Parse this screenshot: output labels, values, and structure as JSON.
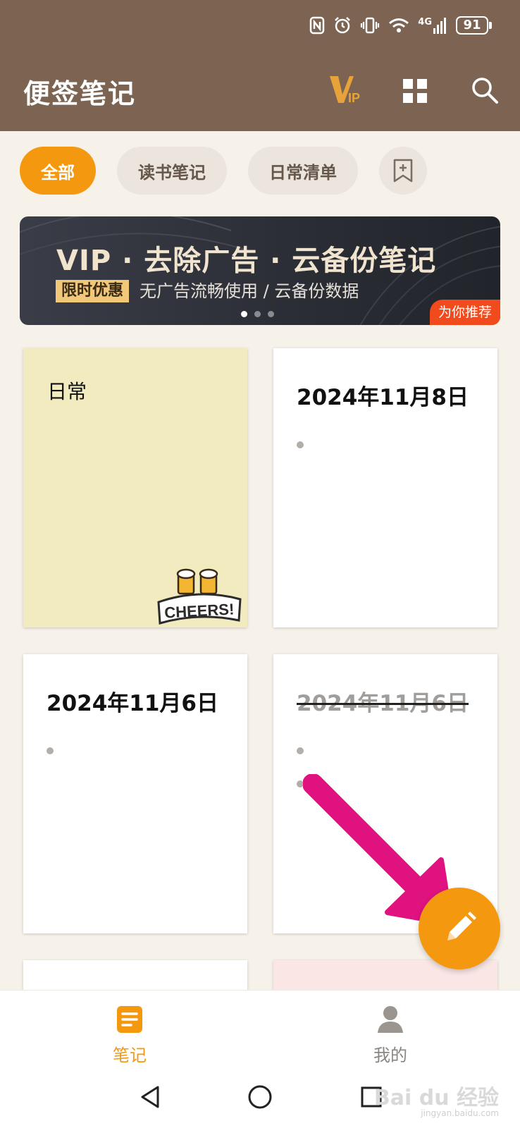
{
  "status_bar": {
    "battery": "91",
    "network": "4G"
  },
  "header": {
    "title": "便签笔记",
    "vip_icon": "vip-icon",
    "grid_icon": "grid-icon",
    "search_icon": "search-icon"
  },
  "tabs": [
    {
      "label": "全部",
      "active": true
    },
    {
      "label": "读书笔记",
      "active": false
    },
    {
      "label": "日常清单",
      "active": false
    }
  ],
  "banner": {
    "title": "VIP · 去除广告 · 云备份笔记",
    "tag": "限时优惠",
    "subtitle": "无广告流畅使用 / 云备份数据",
    "badge": "为你推荐",
    "page_count": 3,
    "active_page": 1
  },
  "notes": [
    {
      "title": "日常",
      "color": "#f1ebbf",
      "sticker": "CHEERS!"
    },
    {
      "title": "2024年11月8日",
      "color": "#ffffff",
      "bullets": 1
    },
    {
      "title": "2024年11月6日",
      "color": "#ffffff",
      "bullets": 1
    },
    {
      "title": "2024年11月6日",
      "color": "#ffffff",
      "bullets": 2,
      "struck": true
    },
    {
      "title": "",
      "color": "#ffffff"
    },
    {
      "title": "",
      "color": "#fbe6e6"
    }
  ],
  "fab": {
    "icon": "pencil-icon"
  },
  "bottom_nav": [
    {
      "label": "笔记",
      "icon": "notes-icon",
      "active": true
    },
    {
      "label": "我的",
      "icon": "profile-icon",
      "active": false
    }
  ],
  "watermark": {
    "text": "Bai du 经验",
    "url_text": "jingyan.baidu.com"
  },
  "colors": {
    "header": "#7d6452",
    "accent": "#f4990f",
    "background": "#f6f2ea",
    "arrow": "#e0127f"
  }
}
